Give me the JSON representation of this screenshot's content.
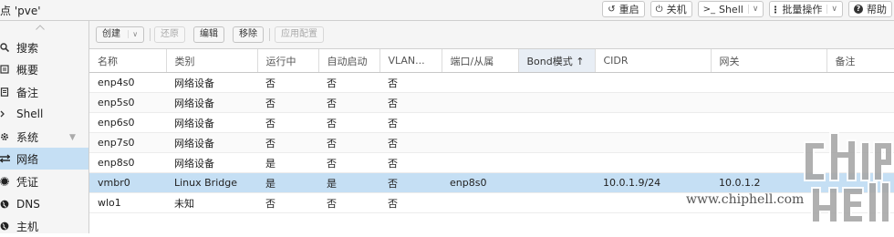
{
  "header": {
    "node_title": "点 'pve'",
    "actions": [
      {
        "label": "重启",
        "icon": "reboot-icon"
      },
      {
        "label": "关机",
        "icon": "power-icon"
      },
      {
        "label": "Shell",
        "icon": "terminal-icon"
      },
      {
        "label": "批量操作",
        "icon": "more-icon"
      },
      {
        "label": "帮助",
        "icon": "help-icon"
      }
    ]
  },
  "sidebar": {
    "items": [
      {
        "label": "搜索",
        "icon": "search-icon"
      },
      {
        "label": "概要",
        "icon": "summary-icon"
      },
      {
        "label": "备注",
        "icon": "notes-icon"
      },
      {
        "label": "Shell",
        "icon": "terminal-icon"
      },
      {
        "label": "系统",
        "icon": "gear-icon"
      },
      {
        "label": "网络",
        "icon": "network-icon",
        "active": true
      },
      {
        "label": "凭证",
        "icon": "certificate-icon"
      },
      {
        "label": "DNS",
        "icon": "globe-icon"
      },
      {
        "label": "主机",
        "icon": "globe-icon"
      }
    ]
  },
  "toolbar": {
    "create": "创建",
    "revert": "还原",
    "edit": "编辑",
    "remove": "移除",
    "apply": "应用配置"
  },
  "table": {
    "columns": [
      "名称",
      "类别",
      "运行中",
      "自动启动",
      "VLAN...",
      "端口/从属",
      "Bond模式 ↑",
      "CIDR",
      "网关",
      "备注"
    ],
    "sorted_column": 6,
    "rows": [
      [
        "enp4s0",
        "网络设备",
        "否",
        "否",
        "否",
        "",
        "",
        "",
        "",
        ""
      ],
      [
        "enp5s0",
        "网络设备",
        "否",
        "否",
        "否",
        "",
        "",
        "",
        "",
        ""
      ],
      [
        "enp6s0",
        "网络设备",
        "否",
        "否",
        "否",
        "",
        "",
        "",
        "",
        ""
      ],
      [
        "enp7s0",
        "网络设备",
        "否",
        "否",
        "否",
        "",
        "",
        "",
        "",
        ""
      ],
      [
        "enp8s0",
        "网络设备",
        "是",
        "否",
        "否",
        "",
        "",
        "",
        "",
        ""
      ],
      [
        "vmbr0",
        "Linux Bridge",
        "是",
        "是",
        "否",
        "enp8s0",
        "",
        "10.0.1.9/24",
        "10.0.1.2",
        ""
      ],
      [
        "wlo1",
        "未知",
        "否",
        "否",
        "否",
        "",
        "",
        "",
        "",
        ""
      ]
    ],
    "selected_row": 5
  },
  "watermark": {
    "url": "www.chiphell.com"
  },
  "colors": {
    "selection": "#c5dff4",
    "toolbar_bg": "#f5f5f5",
    "border": "#cfcfcf"
  }
}
